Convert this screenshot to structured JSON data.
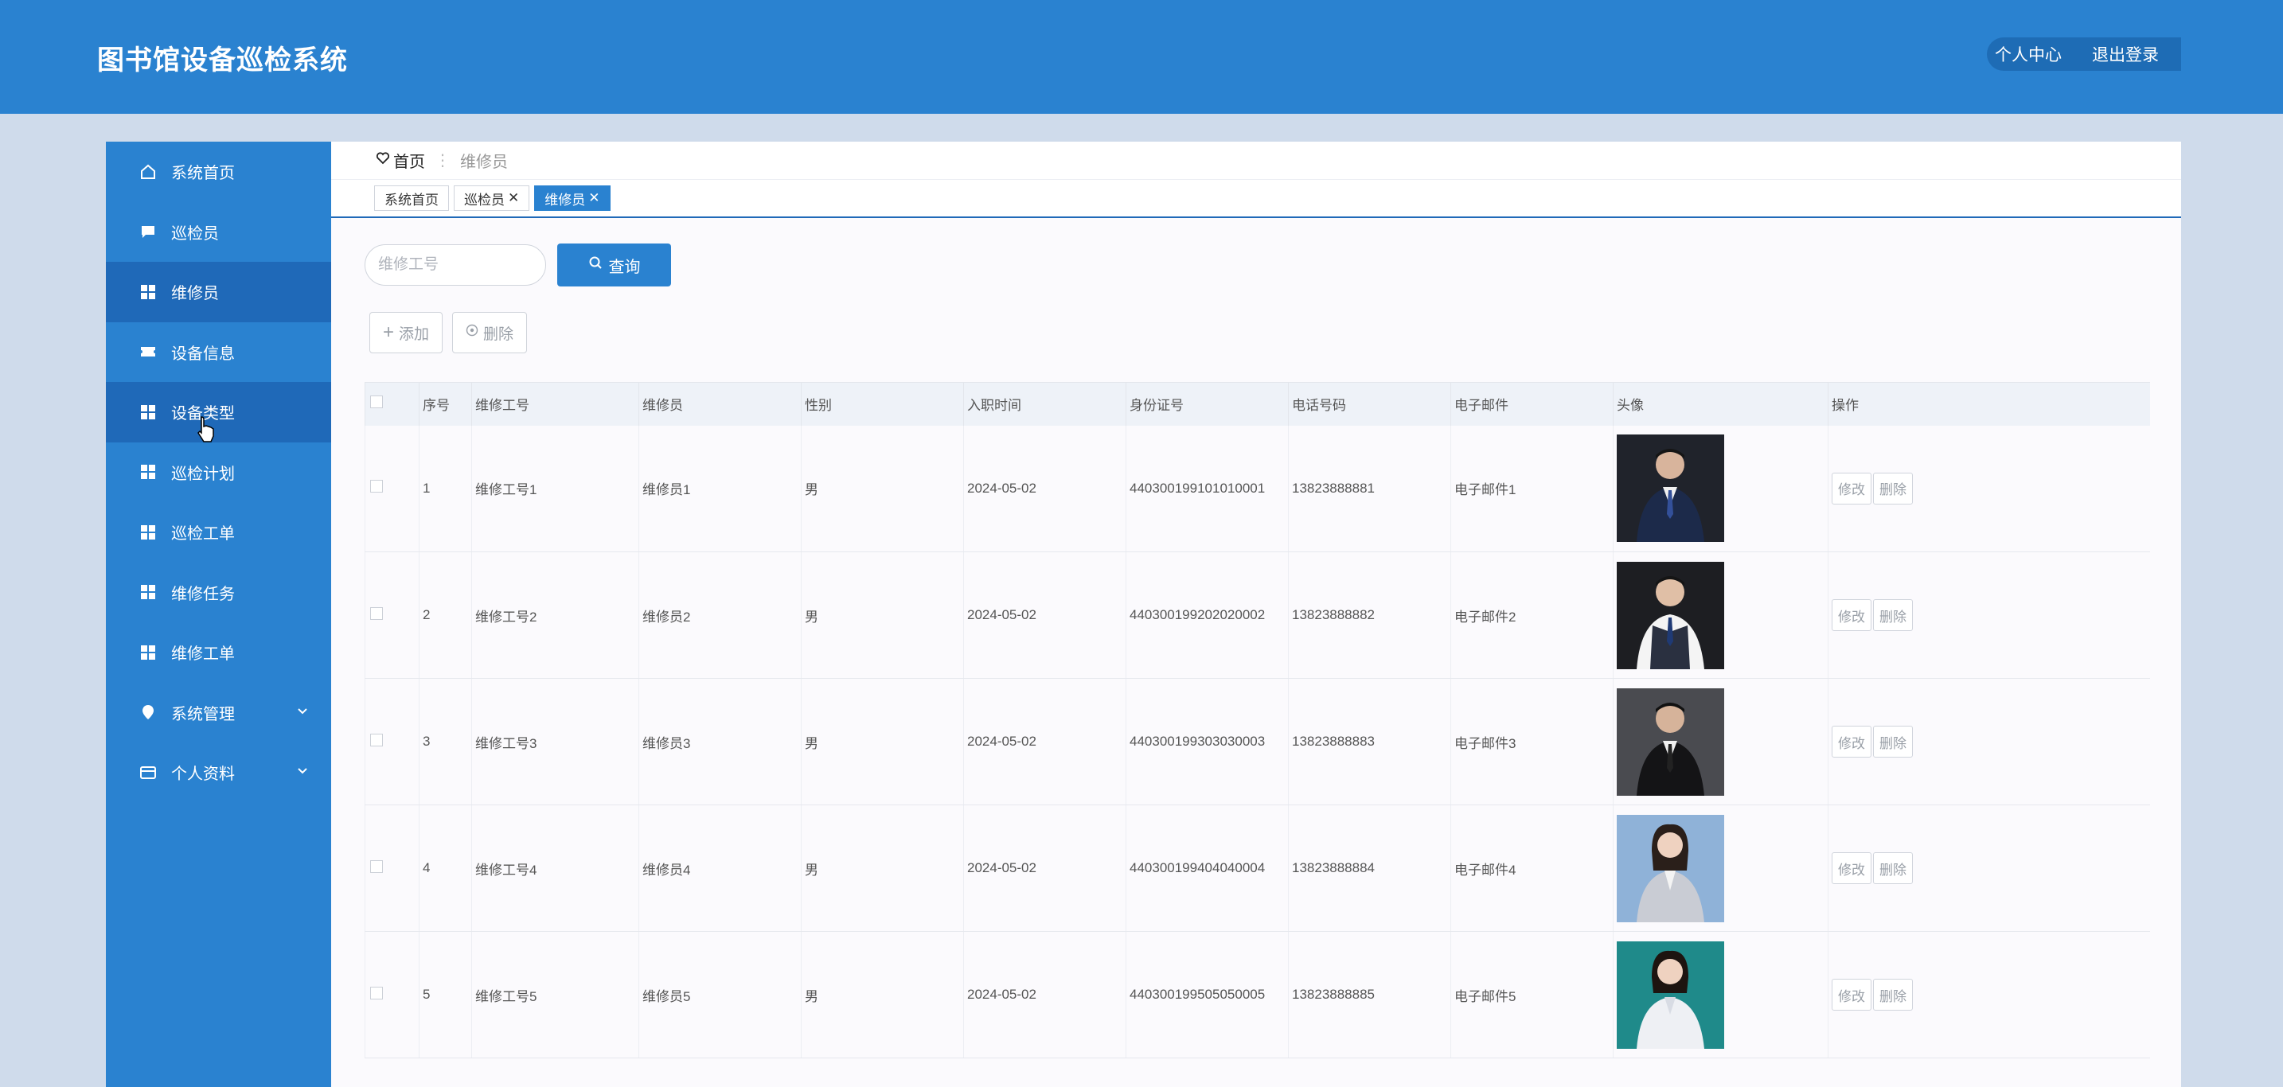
{
  "header": {
    "title": "图书馆设备巡检系统",
    "profile_label": "个人中心",
    "logout_label": "退出登录"
  },
  "sidebar": {
    "items": [
      {
        "label": "系统首页",
        "icon": "home-icon",
        "active": false
      },
      {
        "label": "巡检员",
        "icon": "chat-icon",
        "active": false
      },
      {
        "label": "维修员",
        "icon": "grid-icon",
        "active": true
      },
      {
        "label": "设备信息",
        "icon": "ticket-icon",
        "active": false
      },
      {
        "label": "设备类型",
        "icon": "grid-icon",
        "active": true
      },
      {
        "label": "巡检计划",
        "icon": "grid-icon",
        "active": false
      },
      {
        "label": "巡检工单",
        "icon": "grid-icon",
        "active": false
      },
      {
        "label": "维修任务",
        "icon": "grid-icon",
        "active": false
      },
      {
        "label": "维修工单",
        "icon": "grid-icon",
        "active": false
      },
      {
        "label": "系统管理",
        "icon": "location-pin-icon",
        "active": false,
        "expandable": true
      },
      {
        "label": "个人资料",
        "icon": "card-icon",
        "active": false,
        "expandable": true
      }
    ]
  },
  "breadcrumb": {
    "home": "首页",
    "separator": "⋮",
    "current": "维修员"
  },
  "tabs": [
    {
      "label": "系统首页",
      "closable": false,
      "active": false
    },
    {
      "label": "巡检员",
      "closable": true,
      "active": false
    },
    {
      "label": "维修员",
      "closable": true,
      "active": true
    }
  ],
  "search": {
    "placeholder": "维修工号",
    "value": "",
    "query_label": "查询"
  },
  "actions": {
    "add_label": "添加",
    "delete_label": "删除"
  },
  "table": {
    "columns": [
      "序号",
      "维修工号",
      "维修员",
      "性别",
      "入职时间",
      "身份证号",
      "电话号码",
      "电子邮件",
      "头像",
      "操作"
    ],
    "rows": [
      {
        "index": "1",
        "code": "维修工号1",
        "name": "维修员1",
        "gender": "男",
        "date": "2024-05-02",
        "id_no": "440300199101010001",
        "phone": "13823888881",
        "email": "电子邮件1",
        "avatar": "male-suit-1"
      },
      {
        "index": "2",
        "code": "维修工号2",
        "name": "维修员2",
        "gender": "男",
        "date": "2024-05-02",
        "id_no": "440300199202020002",
        "phone": "13823888882",
        "email": "电子邮件2",
        "avatar": "male-vest-2"
      },
      {
        "index": "3",
        "code": "维修工号3",
        "name": "维修员3",
        "gender": "男",
        "date": "2024-05-02",
        "id_no": "440300199303030003",
        "phone": "13823888883",
        "email": "电子邮件3",
        "avatar": "male-suit-3"
      },
      {
        "index": "4",
        "code": "维修工号4",
        "name": "维修员4",
        "gender": "男",
        "date": "2024-05-02",
        "id_no": "440300199404040004",
        "phone": "13823888884",
        "email": "电子邮件4",
        "avatar": "female-grey-4"
      },
      {
        "index": "5",
        "code": "维修工号5",
        "name": "维修员5",
        "gender": "男",
        "date": "2024-05-02",
        "id_no": "440300199505050005",
        "phone": "13823888885",
        "email": "电子邮件5",
        "avatar": "female-teal-5"
      }
    ],
    "edit_label": "修改",
    "row_delete_label": "删除"
  },
  "colors": {
    "primary": "#2a82d0",
    "primary_dark": "#1f69b8",
    "page_bg": "#cfdbeb"
  }
}
